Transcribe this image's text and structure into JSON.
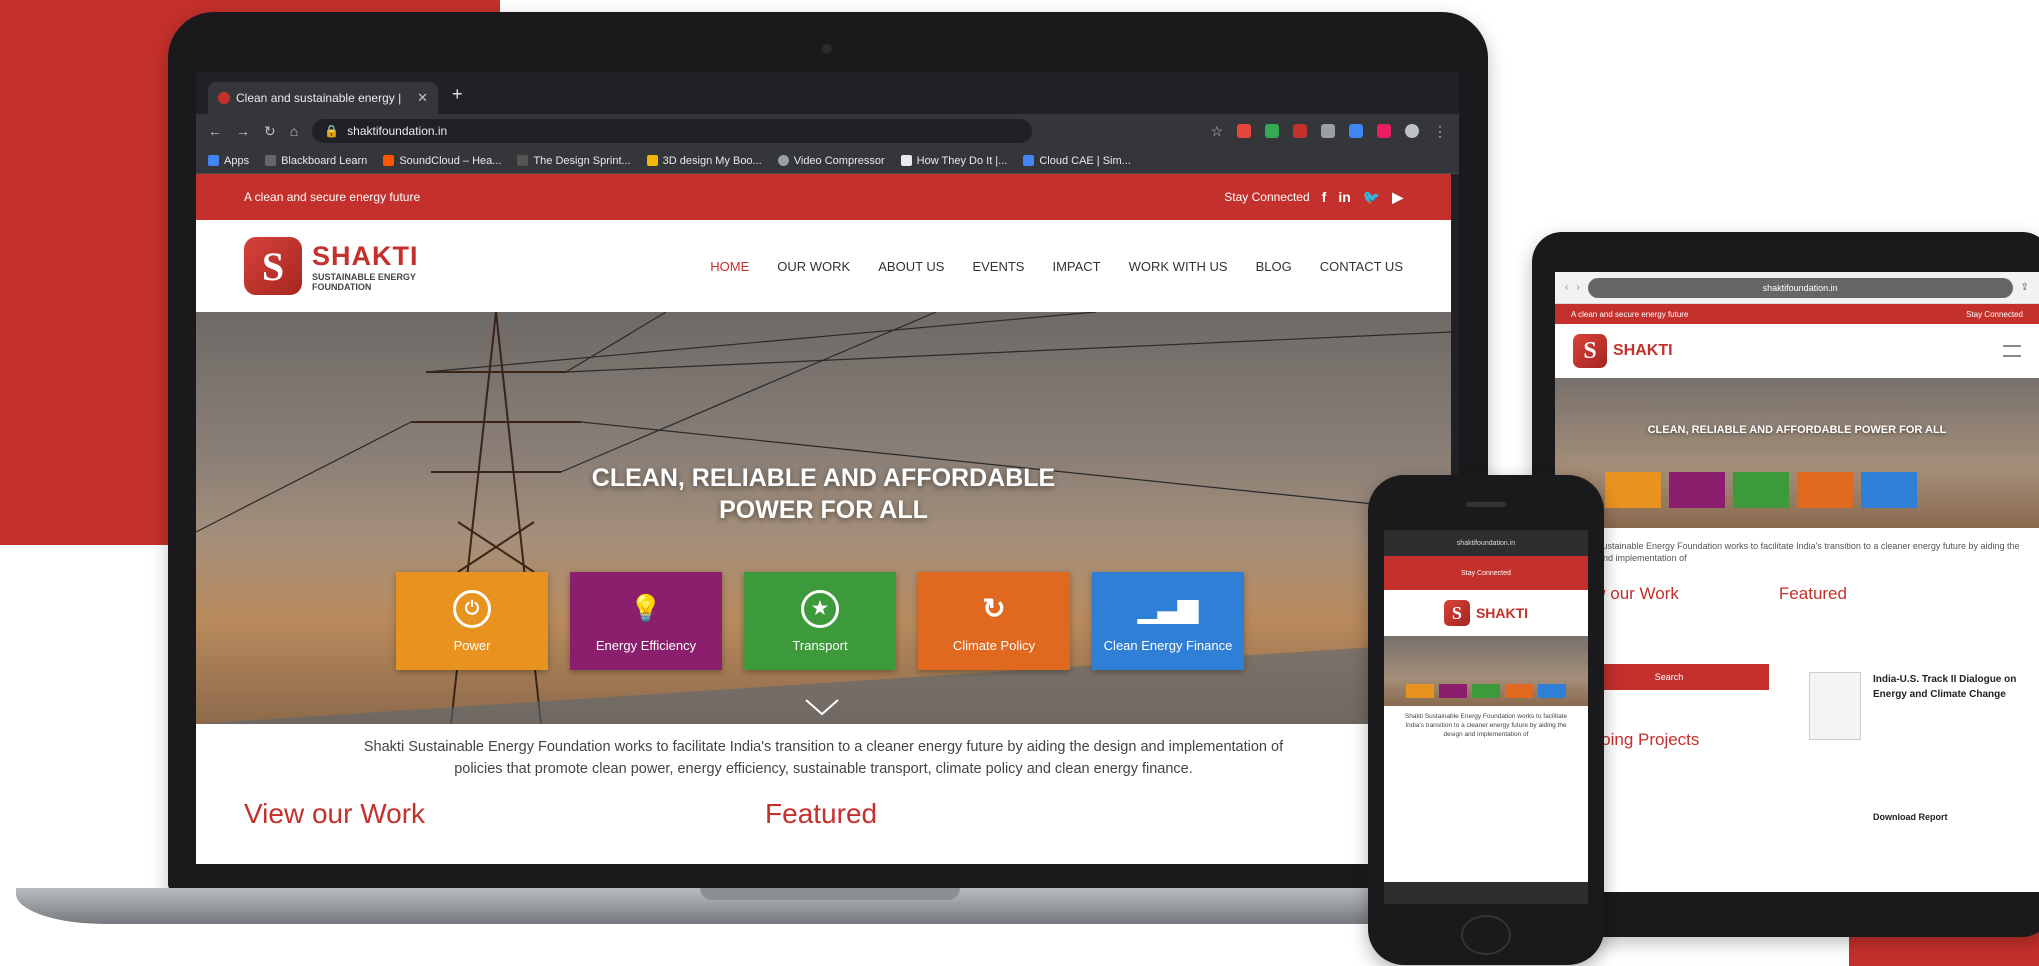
{
  "browser": {
    "tab_title": "Clean and sustainable energy |",
    "tab_close": "✕",
    "new_tab": "+",
    "url": "shaktifoundation.in",
    "bookmarks": [
      "Apps",
      "Blackboard Learn",
      "SoundCloud – Hea...",
      "The Design Sprint...",
      "3D design My Boo...",
      "Video Compressor",
      "How They Do It |...",
      "Cloud CAE | Sim..."
    ]
  },
  "site": {
    "tagline": "A clean and secure energy future",
    "stay_connected": "Stay Connected",
    "logo_name": "SHAKTI",
    "logo_sub1": "SUSTAINABLE ENERGY",
    "logo_sub2": "FOUNDATION",
    "menu": [
      "HOME",
      "OUR WORK",
      "ABOUT US",
      "EVENTS",
      "IMPACT",
      "WORK WITH US",
      "BLOG",
      "CONTACT US"
    ],
    "hero_line1": "CLEAN, RELIABLE AND AFFORDABLE",
    "hero_line2": "POWER FOR ALL",
    "tiles": [
      {
        "label": "Power",
        "color": "#e8921f",
        "icon": "plug-icon"
      },
      {
        "label": "Energy Efficiency",
        "color": "#8b1f6e",
        "icon": "bulb-icon"
      },
      {
        "label": "Transport",
        "color": "#3d9a3a",
        "icon": "star-icon"
      },
      {
        "label": "Climate Policy",
        "color": "#e0681f",
        "icon": "cycle-icon"
      },
      {
        "label": "Clean Energy Finance",
        "color": "#2f7fd6",
        "icon": "chart-icon"
      }
    ],
    "intro_line1": "Shakti Sustainable Energy Foundation works to facilitate India's transition to a cleaner energy future by aiding the design and implementation of",
    "intro_line2": "policies that promote clean power, energy efficiency, sustainable transport, climate policy and clean energy finance.",
    "view_work": "View our Work",
    "featured": "Featured"
  },
  "tablet": {
    "url": "shaktifoundation.in",
    "tagline": "A clean and secure energy future",
    "stay_connected": "Stay Connected",
    "logo_name": "SHAKTI",
    "hero": "CLEAN, RELIABLE AND AFFORDABLE POWER FOR ALL",
    "view_work": "View our Work",
    "featured": "Featured",
    "search_btn": "Search",
    "ongoing": "Ongoing Projects",
    "featured_title": "India-U.S. Track II Dialogue on Energy and Climate Change",
    "download": "Download Report"
  },
  "phone": {
    "url": "shaktifoundation.in",
    "stay_connected": "Stay Connected",
    "logo_name": "SHAKTI"
  },
  "colors": {
    "brand_red": "#c4302b"
  }
}
